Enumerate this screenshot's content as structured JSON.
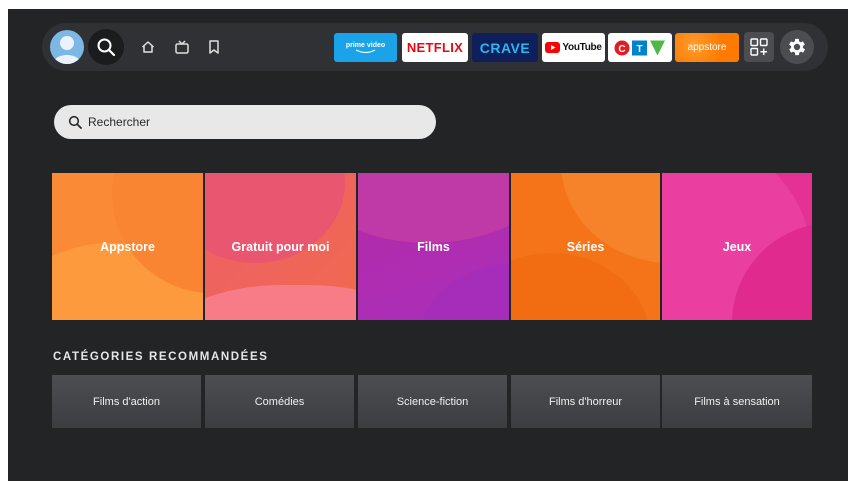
{
  "search": {
    "placeholder": "Rechercher"
  },
  "nav": {
    "icons": [
      "profile-avatar",
      "search-icon",
      "home-icon",
      "live-tv-icon",
      "bookmark-icon"
    ],
    "apps": [
      {
        "name": "prime-video",
        "label": "prime video",
        "color": "#1aa3e8"
      },
      {
        "name": "netflix",
        "label": "NETFLIX",
        "color": "#e50914"
      },
      {
        "name": "crave",
        "label": "CRAVE",
        "color": "#0e1f5b"
      },
      {
        "name": "youtube",
        "label": "YouTube",
        "color": "#ff0000"
      },
      {
        "name": "ctv",
        "label": "CTV",
        "color": "#ffffff"
      },
      {
        "name": "appstore",
        "label": "appstore",
        "color": "#ff7a00"
      }
    ],
    "extra_icons": [
      "app-grid-icon",
      "settings-icon"
    ]
  },
  "categories": [
    {
      "label": "Appstore",
      "color": "#fb8a36"
    },
    {
      "label": "Gratuit pour moi",
      "color": "#f0605c"
    },
    {
      "label": "Films",
      "color": "#b22fb0"
    },
    {
      "label": "Séries",
      "color": "#f57419"
    },
    {
      "label": "Jeux",
      "color": "#e43196"
    }
  ],
  "recommended": {
    "title": "CATÉGORIES RECOMMANDÉES",
    "items": [
      {
        "label": "Films d'action"
      },
      {
        "label": "Comédies"
      },
      {
        "label": "Science-fiction"
      },
      {
        "label": "Films d'horreur"
      },
      {
        "label": "Films à sensation"
      }
    ]
  }
}
